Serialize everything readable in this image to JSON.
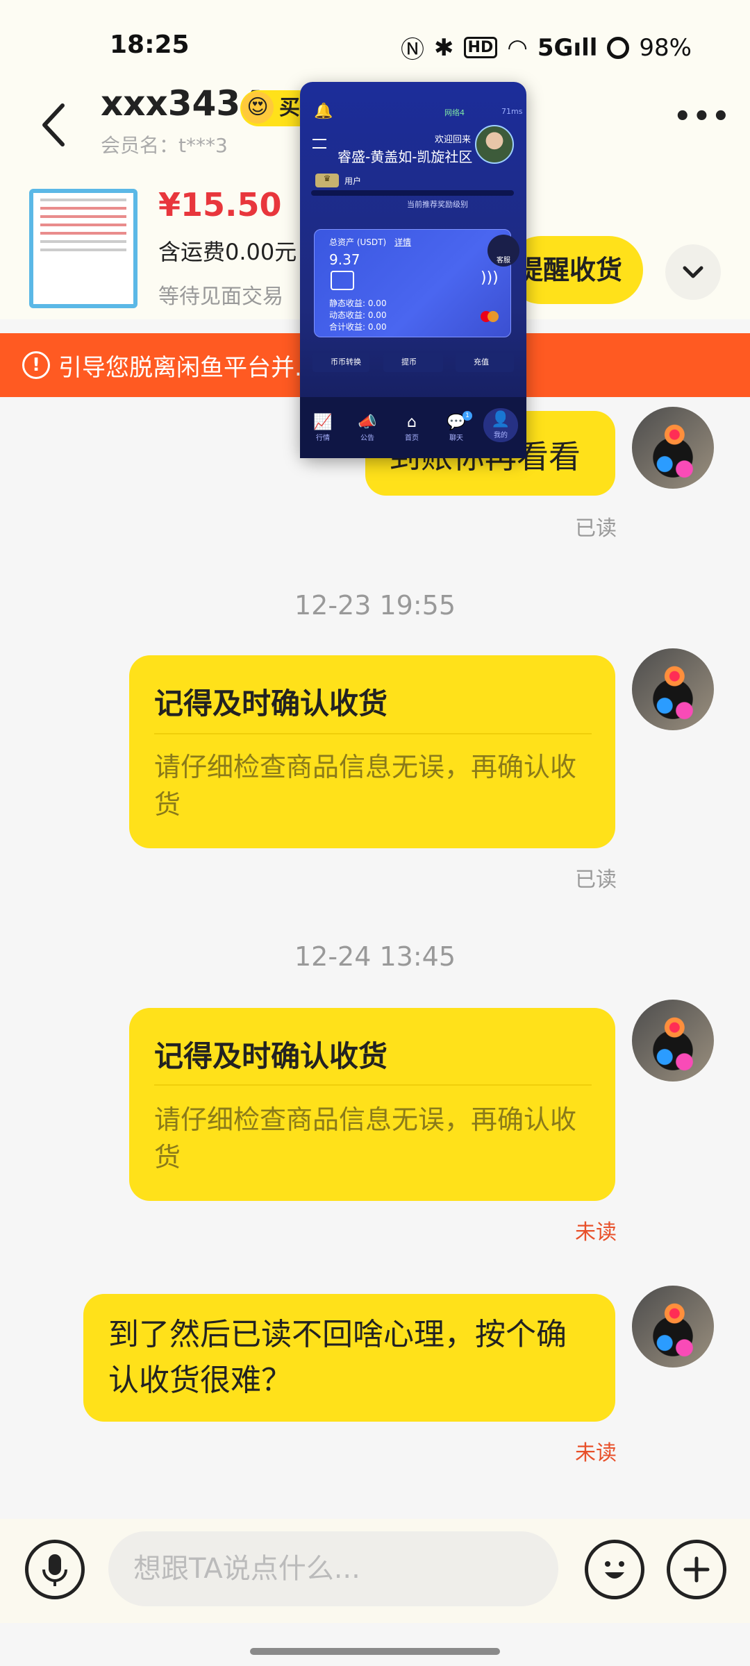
{
  "status_bar": {
    "time": "18:25",
    "battery": "98%",
    "icons": [
      "nfc-icon",
      "bluetooth-icon",
      "hd-icon",
      "wifi-icon",
      "5g-signal-icon",
      "battery-icon"
    ]
  },
  "header": {
    "name": "xxx3434",
    "buyer_badge": "买家",
    "member_label": "会员名：t***3"
  },
  "product": {
    "price": "¥15.50",
    "shipping": "含运费0.00元",
    "trade_status": "等待见面交易",
    "remind_button": "提醒收货"
  },
  "warning": {
    "text": "引导您脱离闲鱼平台并...是诈骗行为！"
  },
  "overlay": {
    "net": "网络4",
    "ms": "71ms",
    "welcome": "欢迎回来",
    "community": "睿盛-黄盖如-凯旋社区",
    "user": "用户",
    "recommend": "当前推荐奖励级别",
    "total_label": "总资产 (USDT)",
    "detail": "详情",
    "total": "9.37",
    "static": "静态收益: 0.00",
    "dynamic": "动态收益: 0.00",
    "sum": "合计收益: 0.00",
    "support": "客服",
    "tabs": [
      "币币转换",
      "提币",
      "充值"
    ],
    "nav": [
      {
        "glyph": "📈",
        "label": "行情"
      },
      {
        "glyph": "📣",
        "label": "公告"
      },
      {
        "glyph": "⌂",
        "label": "首页"
      },
      {
        "glyph": "💬",
        "label": "聊天"
      },
      {
        "glyph": "👤",
        "label": "我的"
      }
    ],
    "badge": "1"
  },
  "messages": [
    {
      "text": "到账你再看看",
      "status": "已读"
    },
    {
      "timestamp": "12-23 19:55",
      "title": "记得及时确认收货",
      "sub": "请仔细检查商品信息无误，再确认收货",
      "status": "已读"
    },
    {
      "timestamp": "12-24 13:45",
      "title": "记得及时确认收货",
      "sub": "请仔细检查商品信息无误，再确认收货",
      "status": "未读"
    },
    {
      "text": "到了然后已读不回啥心理，按个确认收货很难？",
      "status": "未读"
    }
  ],
  "input": {
    "placeholder": "想跟TA说点什么..."
  },
  "colors": {
    "accent_yellow": "#ffe11a",
    "warning_orange": "#ff5a22",
    "price_red": "#e8363c"
  }
}
